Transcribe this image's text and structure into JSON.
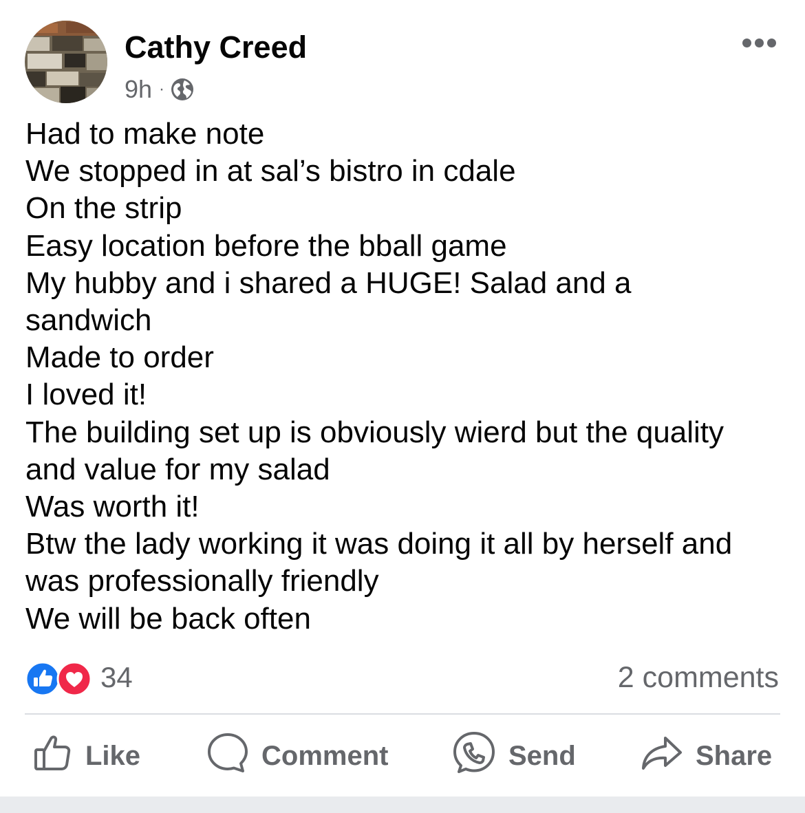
{
  "post": {
    "author": {
      "name": "Cathy Creed",
      "avatar_icon": "stone-wall-photo"
    },
    "timestamp": "9h",
    "separator": "·",
    "audience_icon": "globe-icon",
    "more_icon": "more-options-icon",
    "text_lines": [
      "Had to make note",
      "We stopped in at sal’s bistro in cdale",
      "On the strip",
      "Easy location before the bball game",
      "My hubby and i shared a HUGE! Salad and a",
      "sandwich",
      "Made to order",
      "I loved it!",
      "The building set up is obviously wierd but the quality",
      "and value for my salad",
      "Was worth it!",
      "Btw the lady working it was doing it all by herself and",
      "was professionally friendly",
      "We will be back often"
    ],
    "reactions": {
      "icons": [
        "like-reaction-icon",
        "love-reaction-icon"
      ],
      "count": "34"
    },
    "comments_label": "2 comments"
  },
  "actions": {
    "like": {
      "label": "Like",
      "icon": "thumbs-up-icon"
    },
    "comment": {
      "label": "Comment",
      "icon": "comment-bubble-icon"
    },
    "send": {
      "label": "Send",
      "icon": "messenger-icon"
    },
    "share": {
      "label": "Share",
      "icon": "share-arrow-icon"
    }
  },
  "colors": {
    "text_primary": "#050505",
    "text_secondary": "#65676b",
    "like_blue": "#1877f2",
    "love_red": "#f02849",
    "divider": "#dadde1",
    "background": "#ffffff"
  }
}
